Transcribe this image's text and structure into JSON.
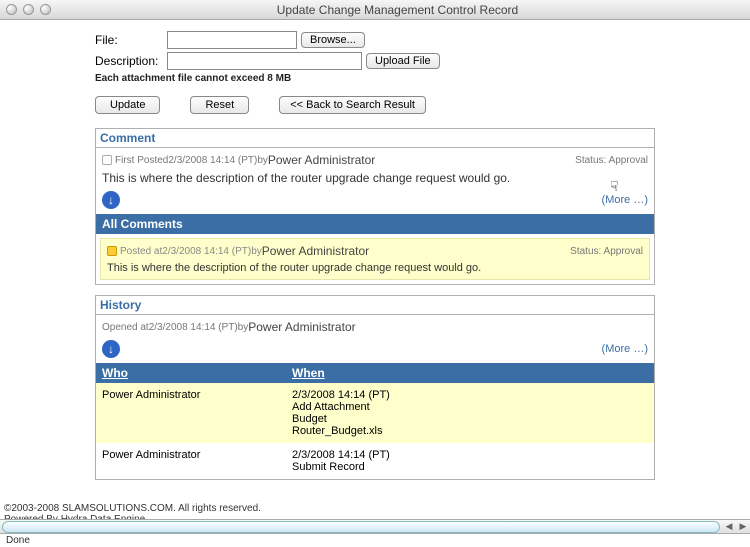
{
  "window": {
    "title": "Update Change Management Control Record"
  },
  "file_form": {
    "file_label": "File:",
    "desc_label": "Description:",
    "browse_label": "Browse...",
    "upload_label": "Upload File",
    "note": "Each attachment file cannot exceed 8 MB",
    "file_value": "",
    "desc_value": ""
  },
  "actions": {
    "update": "Update",
    "reset": "Reset",
    "back": "<< Back to Search Result"
  },
  "comment_panel": {
    "title": "Comment",
    "first_posted_prefix": "First Posted ",
    "timestamp": "2/3/2008 14:14 (PT)",
    "by": " by ",
    "author": "Power Administrator",
    "status_label": "Status: ",
    "status_value": "Approval",
    "body": "This is where the description of the router upgrade change request would go.",
    "more": "(More …)",
    "all_comments": "All Comments",
    "sub_posted_prefix": "Posted at ",
    "sub_timestamp": "2/3/2008 14:14 (PT)",
    "sub_author": "Power Administrator",
    "sub_status_label": "Status: ",
    "sub_status_value": "Approval",
    "sub_body": "This is where the description of the router upgrade change request would go."
  },
  "history_panel": {
    "title": "History",
    "opened_prefix": "Opened at ",
    "timestamp": "2/3/2008 14:14 (PT)",
    "by": " by ",
    "author": "Power Administrator",
    "more": "(More …)",
    "col_who": "Who",
    "col_when": "When",
    "rows": [
      {
        "who": "Power Administrator",
        "when": "2/3/2008 14:14 (PT)\nAdd Attachment\nBudget\nRouter_Budget.xls"
      },
      {
        "who": "Power Administrator",
        "when": "2/3/2008 14:14 (PT)\nSubmit Record"
      }
    ]
  },
  "footer": {
    "copyright": "©2003-2008 SLAMSOLUTIONS.COM. All rights reserved.",
    "powered": "Powered By Hydra Data Engine"
  },
  "statusbar": {
    "text": "Done"
  }
}
